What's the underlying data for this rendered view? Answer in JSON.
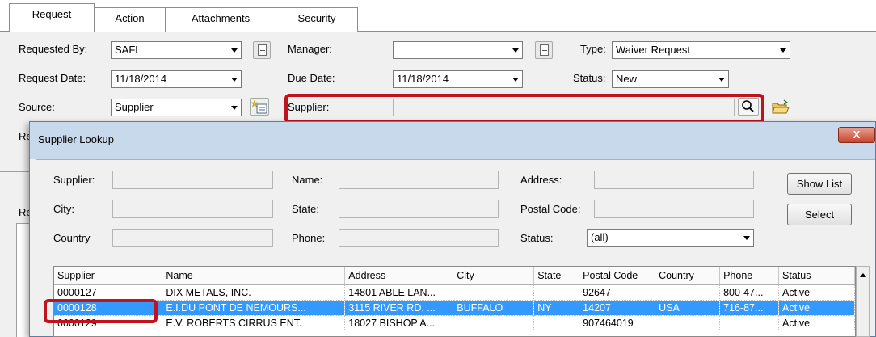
{
  "tabs": [
    "Request",
    "Action",
    "Attachments",
    "Security"
  ],
  "form": {
    "requested_by_label": "Requested By:",
    "requested_by_value": "SAFL",
    "manager_label": "Manager:",
    "manager_value": "",
    "type_label": "Type:",
    "type_value": "Waiver Request",
    "request_date_label": "Request Date:",
    "request_date_value": "11/18/2014",
    "due_date_label": "Due Date:",
    "due_date_value": "11/18/2014",
    "status_label": "Status:",
    "status_value": "New",
    "source_label": "Source:",
    "source_value": "Supplier",
    "supplier_label": "Supplier:",
    "supplier_value": "",
    "clipped_label_1": "Re",
    "clipped_label_2": "Re"
  },
  "dialog": {
    "title": "Supplier Lookup",
    "close_label": "X",
    "supplier_label": "Supplier:",
    "name_label": "Name:",
    "address_label": "Address:",
    "city_label": "City:",
    "state_label": "State:",
    "postal_code_label": "Postal Code:",
    "country_label": "Country",
    "phone_label": "Phone:",
    "status_label": "Status:",
    "status_value": "(all)",
    "show_list_label": "Show List",
    "select_label": "Select"
  },
  "grid": {
    "columns": [
      "Supplier",
      "Name",
      "Address",
      "City",
      "State",
      "Postal Code",
      "Country",
      "Phone",
      "Status"
    ],
    "rows": [
      [
        "0000127",
        "DIX METALS, INC.",
        "14801 ABLE LAN...",
        "",
        "",
        "92647",
        "",
        "800-47...",
        "Active"
      ],
      [
        "0000128",
        "E.I.DU PONT DE NEMOURS...",
        "3115 RIVER RD. ...",
        "BUFFALO",
        "NY",
        "14207",
        "USA",
        "716-87...",
        "Active"
      ],
      [
        "0000129",
        "E.V. ROBERTS CIRRUS ENT.",
        "18027  BISHOP A...",
        "",
        "",
        "907464019",
        "",
        "",
        "Active"
      ]
    ],
    "selected_row": 1
  },
  "colors": {
    "highlight": "#c0131b",
    "selection": "#3399ff",
    "title_bar": "#c9d9ec"
  }
}
